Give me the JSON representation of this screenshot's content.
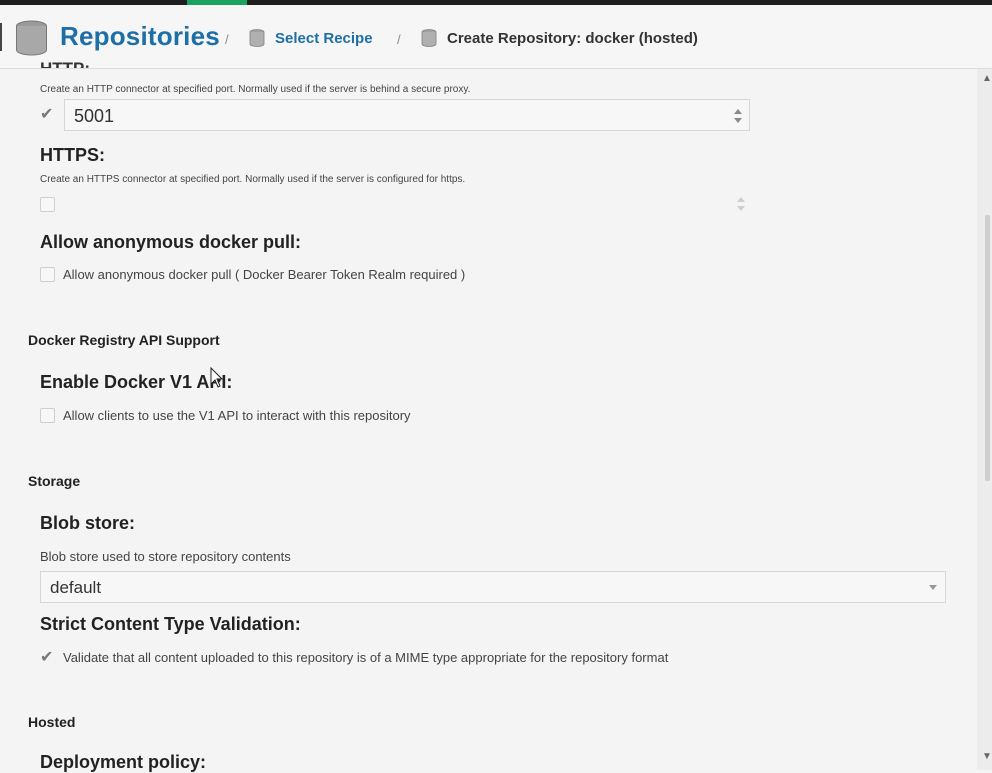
{
  "header": {
    "title": "Repositories",
    "separator": "/",
    "crumb_recipe": "Select Recipe",
    "crumb_current": "Create Repository: docker (hosted)"
  },
  "http": {
    "title_cut": "HTTP:",
    "help": "Create an HTTP connector at specified port. Normally used if the server is behind a secure proxy.",
    "checked": true,
    "port": "5001"
  },
  "https": {
    "title": "HTTPS:",
    "help": "Create an HTTPS connector at specified port. Normally used if the server is configured for https.",
    "checked": false,
    "port": ""
  },
  "anon_pull": {
    "title": "Allow anonymous docker pull:",
    "label": "Allow anonymous docker pull ( Docker Bearer Token Realm required )",
    "checked": false
  },
  "registry_section": "Docker Registry API Support",
  "v1": {
    "title": "Enable Docker V1 API:",
    "label": "Allow clients to use the V1 API to interact with this repository",
    "checked": false
  },
  "storage_section": "Storage",
  "blob": {
    "title": "Blob store:",
    "help": "Blob store used to store repository contents",
    "value": "default"
  },
  "strict": {
    "title": "Strict Content Type Validation:",
    "label": "Validate that all content uploaded to this repository is of a MIME type appropriate for the repository format",
    "checked": true
  },
  "hosted_section": "Hosted",
  "deployment": {
    "title": "Deployment policy:"
  },
  "colors": {
    "brand_blue": "#1e6fa6",
    "accent_green": "#1aa260"
  }
}
